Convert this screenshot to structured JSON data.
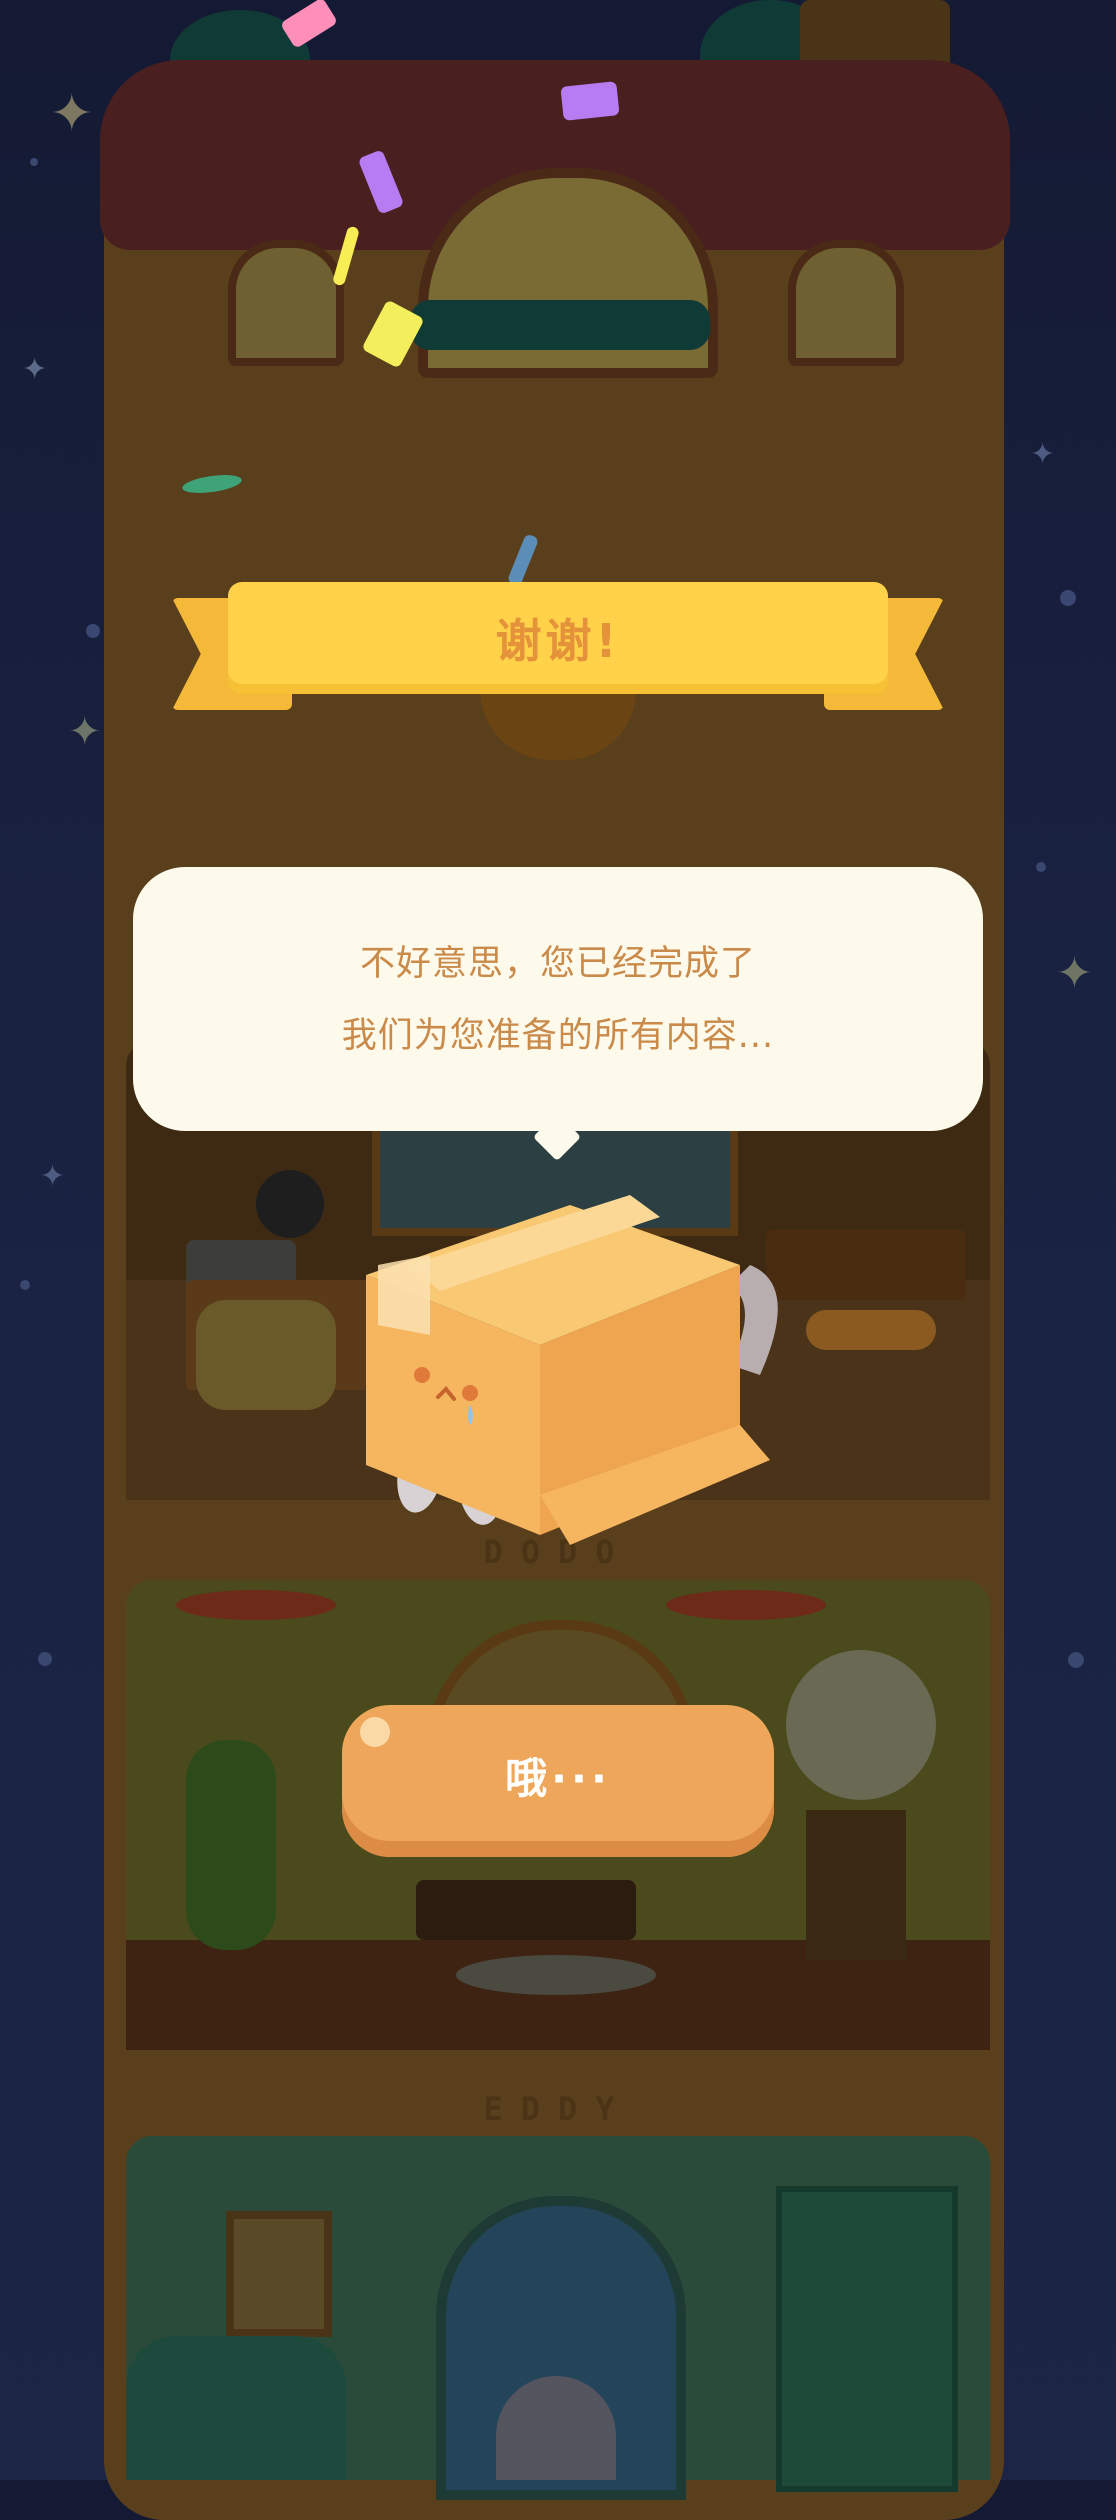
{
  "banner": {
    "title": "谢谢!"
  },
  "dialog": {
    "lines": [
      "不好意思，您已经完成了",
      "我们为您准备的所有内容..."
    ]
  },
  "ok_button": {
    "label": "哦···"
  },
  "rooms": [
    {
      "label": "DODO"
    },
    {
      "label": "EDDY"
    }
  ],
  "colors": {
    "background": "#1a2242",
    "banner": "#ffd24a",
    "banner_text": "#e5933a",
    "bubble": "#fdfaec",
    "bubble_text": "#c98a4a",
    "button": "#eea75a",
    "box_mascot": "#f5b25a"
  },
  "icons": [
    "sparkle-star-icon",
    "cardboard-box-mascot-icon",
    "confetti-icon"
  ]
}
